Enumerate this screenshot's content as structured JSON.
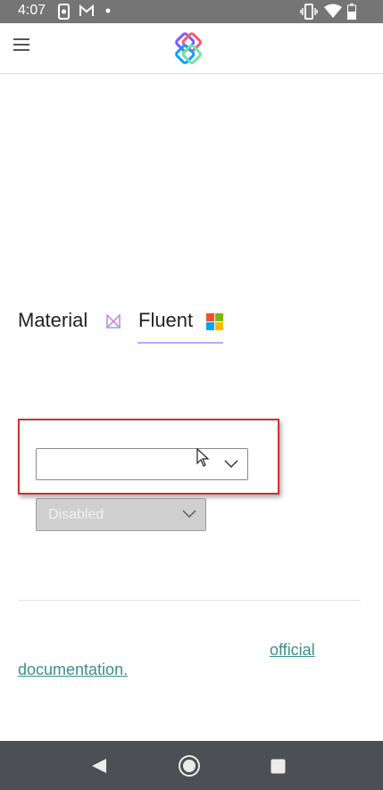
{
  "status_bar": {
    "time": "4:07",
    "icons": [
      "screen-record-icon",
      "gmail-icon",
      "dot-icon",
      "vibrate-icon",
      "wifi-icon",
      "battery-icon"
    ]
  },
  "app_bar": {
    "menu_icon": "hamburger-menu-icon",
    "logo": "uno-platform-logo"
  },
  "tabs": {
    "material_label": "Material",
    "fluent_label": "Fluent",
    "selected": "Fluent"
  },
  "combos": {
    "enabled_value": "",
    "disabled_label": "Disabled"
  },
  "footer": {
    "link_line1": "official",
    "link_line2": "documentation."
  },
  "colors": {
    "status_bar": "#757575",
    "nav_bar": "#4c4f53",
    "tab_underline": "#b9a8ff",
    "highlight_border": "#d32f2f",
    "link": "#3d8f8a"
  }
}
